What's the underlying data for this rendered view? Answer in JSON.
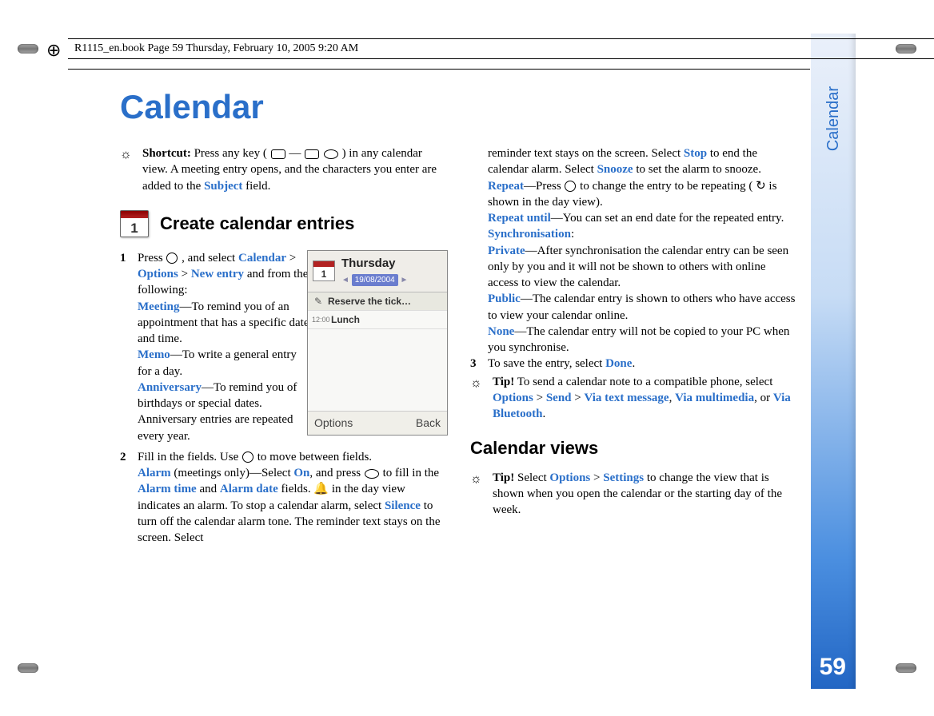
{
  "header": {
    "text": "R1115_en.book  Page 59  Thursday, February 10, 2005  9:20 AM"
  },
  "title": "Calendar",
  "side_label": "Calendar",
  "page_number": "59",
  "shortcut": {
    "label": "Shortcut:",
    "body_a": " Press any key ( ",
    "body_b": " — ",
    "body_c": " ) in any calendar view. A meeting entry opens, and the characters you enter are added to the ",
    "subject": "Subject",
    "body_d": " field."
  },
  "section_create_title": "Create calendar entries",
  "cal_icon_day": "1",
  "phone": {
    "mini_day": "1",
    "day": "Thursday",
    "date": "19/08/2004",
    "row1": "Reserve the tick…",
    "row2_time": "12:00",
    "row2": "Lunch",
    "soft_left": "Options",
    "soft_right": "Back"
  },
  "step1": {
    "num": "1",
    "a": " Press ",
    "b": " , and select ",
    "calendar": "Calendar",
    "gt1": " > ",
    "options": "Options",
    "gt2": " > ",
    "newentry": "New entry",
    "c": " and from the following:",
    "meeting": "Meeting",
    "meeting_t": "—To remind you of an appointment that has a specific date and time.",
    "memo": "Memo",
    "memo_t": "—To write a general entry for a day.",
    "anniv": "Anniversary",
    "anniv_t": "—To remind you of birthdays or special dates. Anniversary entries are repeated every year."
  },
  "step2": {
    "num": "2",
    "a": "Fill in the fields. Use ",
    "b": " to move between fields.",
    "alarm": "Alarm",
    "alarm_t1": " (meetings only)—Select ",
    "on": "On",
    "alarm_t2": ", and press ",
    "alarm_t3": " to fill in the ",
    "alarm_time": "Alarm time",
    "and": " and ",
    "alarm_date": "Alarm date",
    "alarm_t4": " fields. ",
    "alarm_t5": " in the day view indicates an alarm. To stop a calendar alarm, select ",
    "silence": "Silence",
    "alarm_t6": " to turn off the calendar alarm tone. The reminder text stays on the screen. Select ",
    "stop": "Stop",
    "alarm_t7": " to end the calendar alarm. Select ",
    "snooze": "Snooze",
    "alarm_t8": " to set the alarm to snooze.",
    "repeat": "Repeat",
    "repeat_t1": "—Press ",
    "repeat_t2": " to change the entry to be repeating ( ",
    "repeat_t3": " is shown in the day view).",
    "repeat_until": "Repeat until",
    "repeat_until_t": "—You can set an end date for the repeated entry.",
    "sync": "Synchronisation",
    "sync_colon": ":",
    "private": "Private",
    "private_t": "—After synchronisation the calendar entry can be seen only by you and it will not be shown to others with online access to view the calendar.",
    "public": "Public",
    "public_t": "—The calendar entry is shown to others who have access to view your calendar online.",
    "none": "None",
    "none_t": "—The calendar entry will not be copied to your PC when you synchronise."
  },
  "step3": {
    "num": "3",
    "a": "To save the entry, select ",
    "done": "Done",
    "b": "."
  },
  "tip1": {
    "label": "Tip!",
    "a": " To send a calendar note to a compatible phone, select ",
    "options": "Options",
    "gt": " > ",
    "send": "Send",
    "gt2": " > ",
    "via_text": "Via text message",
    "comma": ", ",
    "via_mm": "Via multimedia",
    "or": ", or ",
    "via_bt": "Via Bluetooth",
    "dot": "."
  },
  "views_title": "Calendar views",
  "tip2": {
    "label": "Tip!",
    "a": " Select ",
    "options": "Options",
    "gt": " > ",
    "settings": "Settings",
    "b": " to change the view that is shown when you open the calendar or the starting day of the week."
  }
}
